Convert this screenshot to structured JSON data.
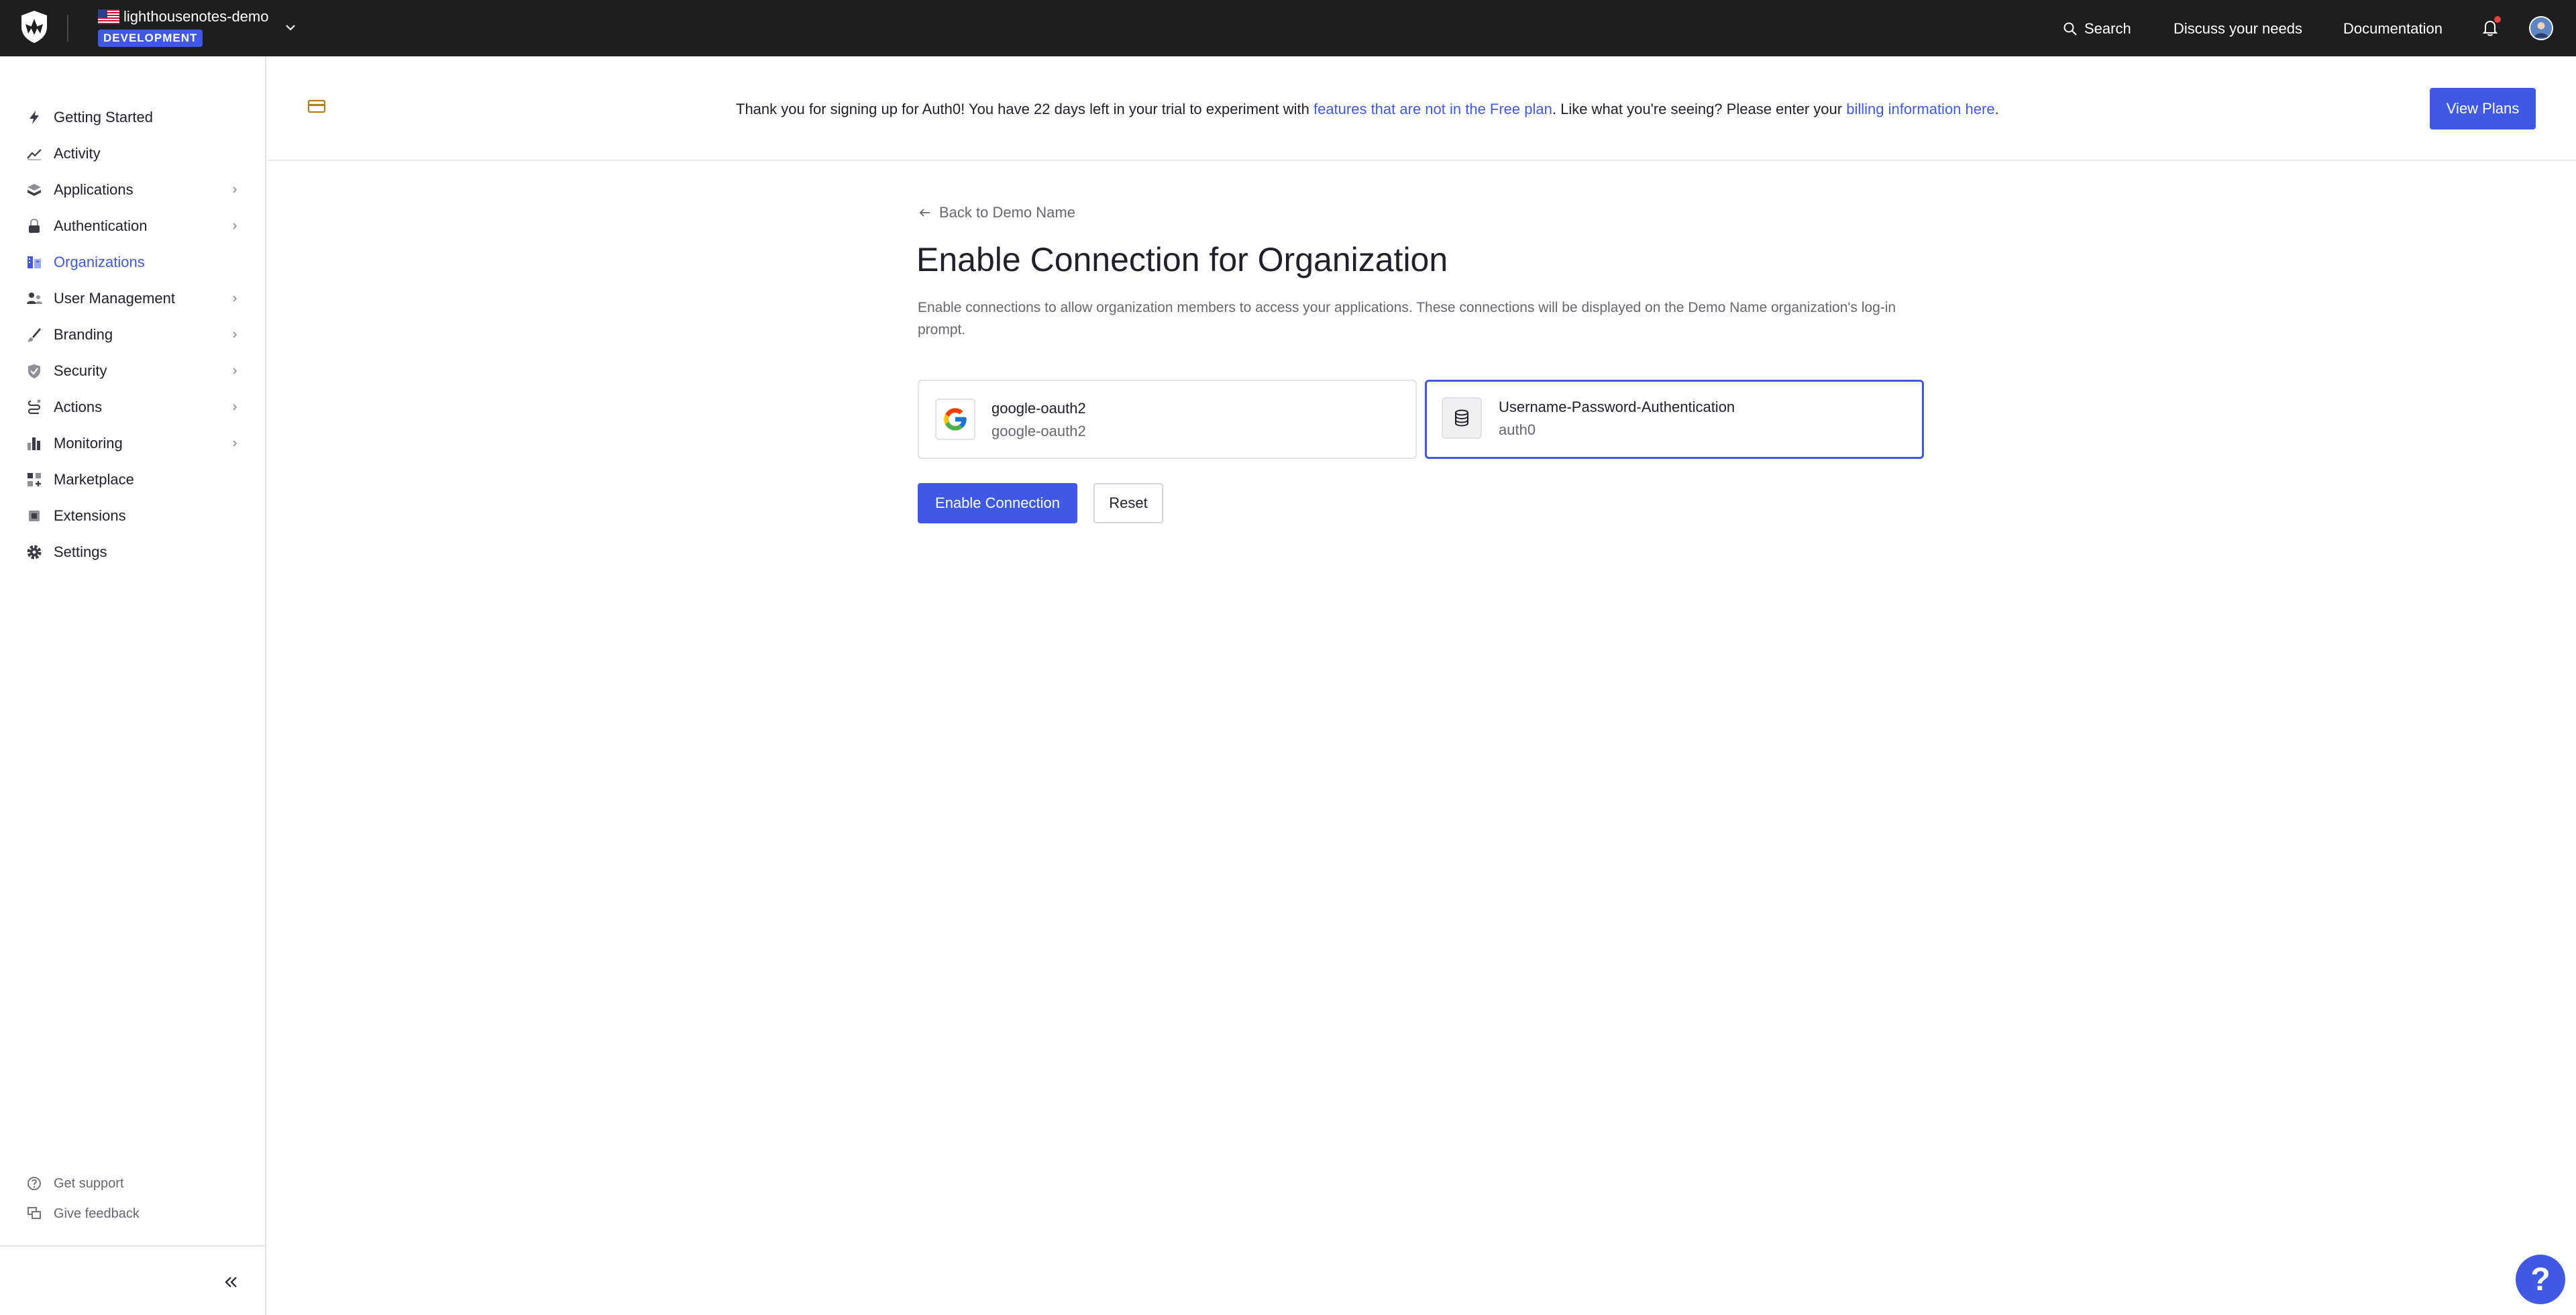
{
  "topbar": {
    "tenant_name": "lighthousenotes-demo",
    "environment": "DEVELOPMENT",
    "search_label": "Search",
    "discuss_label": "Discuss your needs",
    "docs_label": "Documentation"
  },
  "sidebar": {
    "items": [
      {
        "label": "Getting Started",
        "icon": "lightning-icon",
        "chevron": false,
        "active": false
      },
      {
        "label": "Activity",
        "icon": "activity-chart-icon",
        "chevron": false,
        "active": false
      },
      {
        "label": "Applications",
        "icon": "applications-icon",
        "chevron": true,
        "active": false
      },
      {
        "label": "Authentication",
        "icon": "lock-icon",
        "chevron": true,
        "active": false
      },
      {
        "label": "Organizations",
        "icon": "organizations-icon",
        "chevron": false,
        "active": true
      },
      {
        "label": "User Management",
        "icon": "users-icon",
        "chevron": true,
        "active": false
      },
      {
        "label": "Branding",
        "icon": "brush-icon",
        "chevron": true,
        "active": false
      },
      {
        "label": "Security",
        "icon": "shield-check-icon",
        "chevron": true,
        "active": false
      },
      {
        "label": "Actions",
        "icon": "actions-icon",
        "chevron": true,
        "active": false
      },
      {
        "label": "Monitoring",
        "icon": "bar-chart-icon",
        "chevron": true,
        "active": false
      },
      {
        "label": "Marketplace",
        "icon": "marketplace-icon",
        "chevron": false,
        "active": false
      },
      {
        "label": "Extensions",
        "icon": "extensions-icon",
        "chevron": false,
        "active": false
      },
      {
        "label": "Settings",
        "icon": "gear-icon",
        "chevron": false,
        "active": false
      }
    ],
    "footer": {
      "support_label": "Get support",
      "feedback_label": "Give feedback"
    }
  },
  "banner": {
    "text_before": "Thank you for signing up for Auth0! You have 22 days left in your trial to experiment with ",
    "link1": "features that are not in the Free plan",
    "text_middle": ". Like what you're seeing? Please enter your ",
    "link2": "billing information here",
    "text_after": ".",
    "button_label": "View Plans"
  },
  "main": {
    "back_label": "Back to Demo Name",
    "title": "Enable Connection for Organization",
    "description": "Enable connections to allow organization members to access your applications. These connections will be displayed on the Demo Name organization's log-in prompt.",
    "connections": [
      {
        "name": "google-oauth2",
        "strategy": "google-oauth2",
        "selected": false
      },
      {
        "name": "Username-Password-Authentication",
        "strategy": "auth0",
        "selected": true
      }
    ],
    "enable_button": "Enable Connection",
    "reset_button": "Reset"
  },
  "colors": {
    "accent": "#3f59e4",
    "topbar_bg": "#1e1e1e",
    "banner_icon": "#b07d1a",
    "notification_dot": "#e8413e"
  }
}
